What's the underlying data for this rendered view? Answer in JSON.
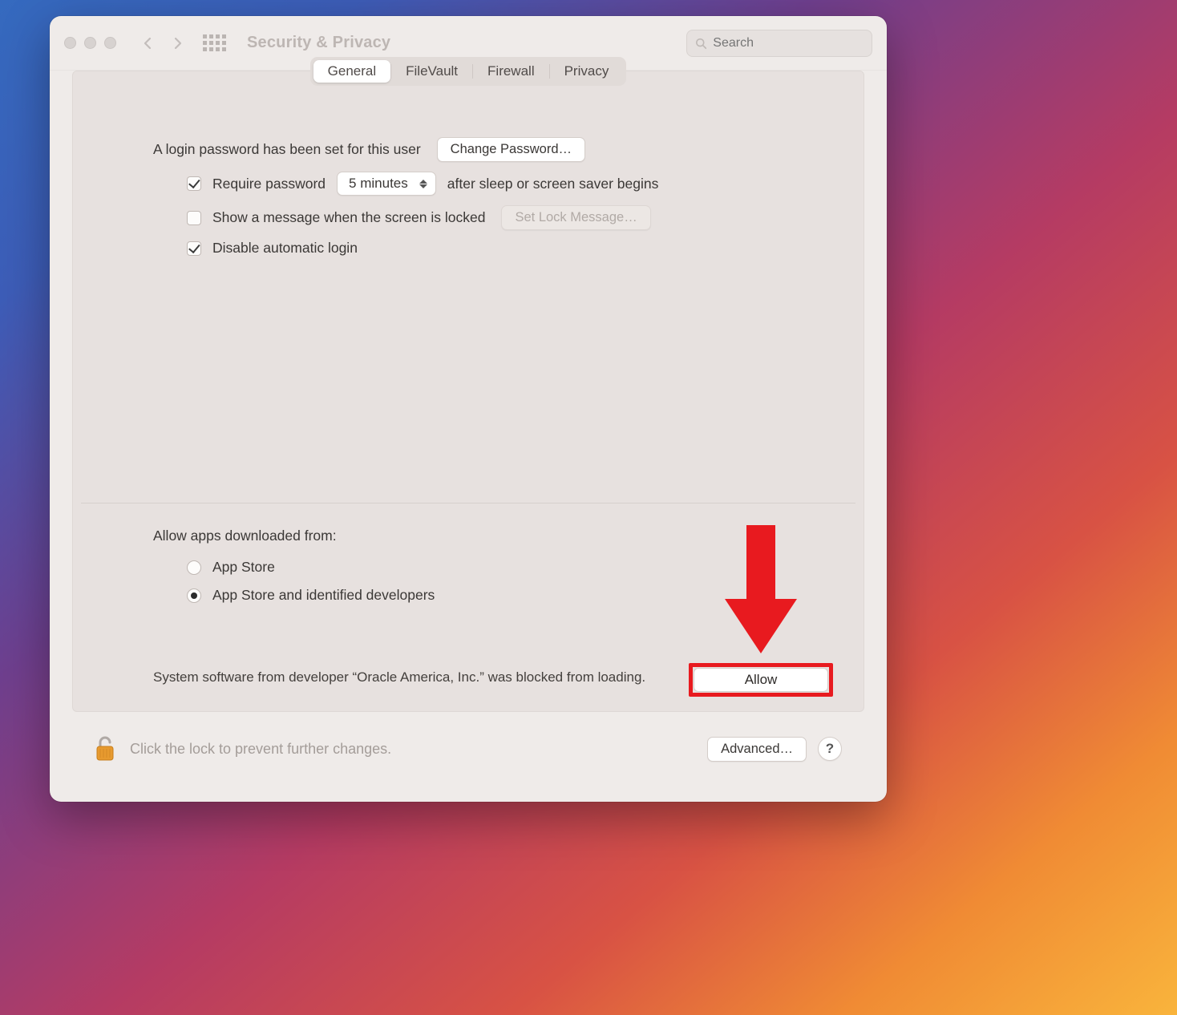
{
  "window": {
    "title": "Security & Privacy"
  },
  "search": {
    "placeholder": "Search"
  },
  "tabs": [
    {
      "label": "General",
      "active": true
    },
    {
      "label": "FileVault",
      "active": false
    },
    {
      "label": "Firewall",
      "active": false
    },
    {
      "label": "Privacy",
      "active": false
    }
  ],
  "login": {
    "password_set_text": "A login password has been set for this user",
    "change_password_btn": "Change Password…",
    "require_password_label": "Require password",
    "require_password_checked": true,
    "require_password_delay": "5 minutes",
    "after_sleep_text": "after sleep or screen saver begins",
    "show_message_label": "Show a message when the screen is locked",
    "show_message_checked": false,
    "set_lock_message_btn": "Set Lock Message…",
    "disable_auto_login_label": "Disable automatic login",
    "disable_auto_login_checked": true
  },
  "allow_apps": {
    "heading": "Allow apps downloaded from:",
    "options": [
      {
        "label": "App Store",
        "selected": false
      },
      {
        "label": "App Store and identified developers",
        "selected": true
      }
    ]
  },
  "blocked": {
    "text": "System software from developer “Oracle America, Inc.” was blocked from loading.",
    "allow_btn": "Allow"
  },
  "footer": {
    "lock_text": "Click the lock to prevent further changes.",
    "advanced_btn": "Advanced…",
    "help_btn": "?"
  }
}
